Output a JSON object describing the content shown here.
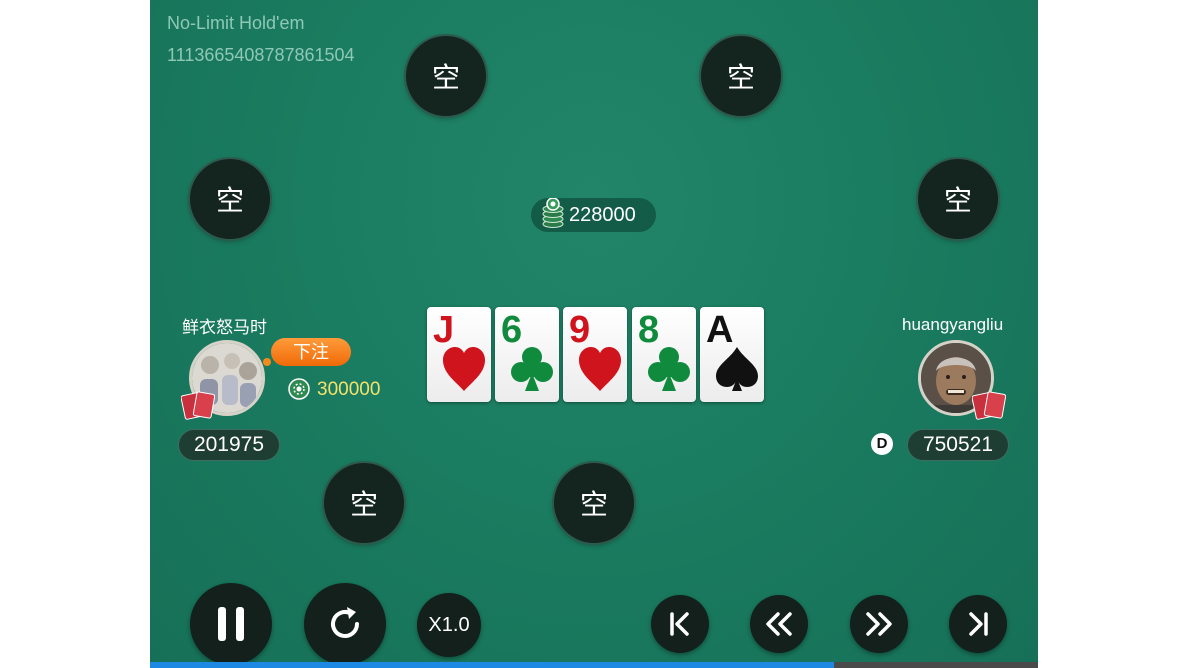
{
  "game": {
    "name": "No-Limit Hold'em",
    "id": "1113665408787861504"
  },
  "empty_seat_label": "空",
  "pot": {
    "amount": "228000"
  },
  "board": [
    {
      "rank": "J",
      "suit": "hearts",
      "color": "#d0141d"
    },
    {
      "rank": "6",
      "suit": "clubs",
      "color": "#108a3c"
    },
    {
      "rank": "9",
      "suit": "hearts",
      "color": "#d0141d"
    },
    {
      "rank": "8",
      "suit": "clubs",
      "color": "#108a3c"
    },
    {
      "rank": "A",
      "suit": "spades",
      "color": "#111111"
    }
  ],
  "players": {
    "left": {
      "name": "鲜衣怒马时",
      "action": "下注",
      "bet": "300000",
      "stack": "201975"
    },
    "right": {
      "name": "huangyangliu",
      "stack": "750521",
      "dealer_label": "D"
    }
  },
  "controls": {
    "pause_icon": "pause-icon",
    "replay_icon": "replay-icon",
    "speed": "X1.0",
    "first_icon": "skip-to-start-icon",
    "rewind_icon": "rewind-icon",
    "forward_icon": "fast-forward-icon",
    "last_icon": "skip-to-end-icon"
  },
  "progress": 0.77,
  "colors": {
    "felt": "#1a7c60",
    "action_badge": "#f5801a",
    "bet_text": "#f3e36b",
    "progress": "#1e88e5"
  }
}
